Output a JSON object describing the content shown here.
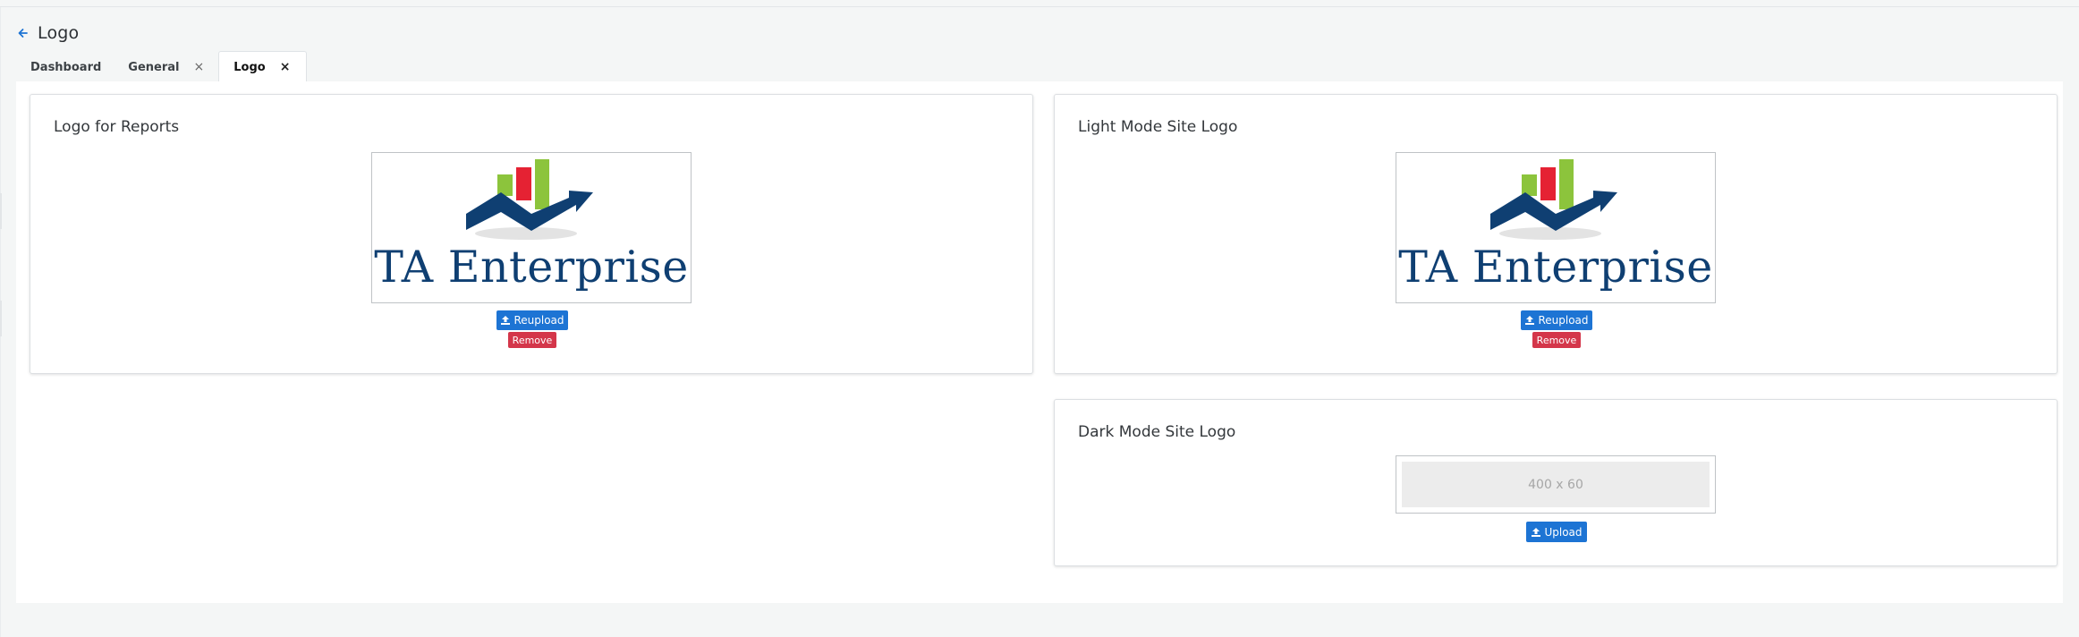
{
  "page": {
    "title": "Logo"
  },
  "tabs": [
    {
      "label": "Dashboard",
      "closable": false,
      "active": false
    },
    {
      "label": "General",
      "closable": true,
      "active": false
    },
    {
      "label": "Logo",
      "closable": true,
      "active": true
    }
  ],
  "tab_close_glyph": "×",
  "icons": {
    "back": "arrow-left-icon",
    "upload": "upload-icon",
    "close": "close-icon"
  },
  "colors": {
    "primary_button": "#1d74d4",
    "danger_button": "#d4364a",
    "logo_text": "#0f3f72",
    "logo_chart_green": "#8cc43c",
    "logo_chart_red": "#e52233"
  },
  "logo_image": {
    "text": "TA Enterprise"
  },
  "cards": {
    "reports": {
      "title": "Logo for Reports",
      "primary_button": "Reupload",
      "remove_button": "Remove"
    },
    "light": {
      "title": "Light Mode Site Logo",
      "primary_button": "Reupload",
      "remove_button": "Remove"
    },
    "dark": {
      "title": "Dark Mode Site Logo",
      "placeholder_text": "400 x 60",
      "primary_button": "Upload"
    }
  }
}
